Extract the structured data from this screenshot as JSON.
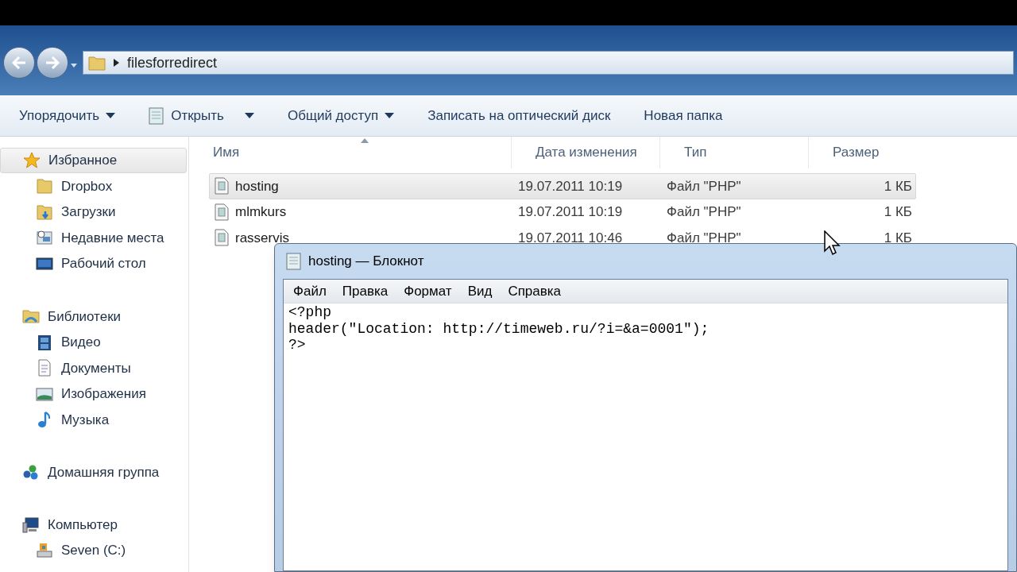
{
  "explorer": {
    "address": {
      "path": "filesforredirect"
    },
    "toolbar": [
      {
        "label": "Упорядочить",
        "kind": "dropdown"
      },
      {
        "label": "Открыть",
        "kind": "open"
      },
      {
        "label": "Общий доступ",
        "kind": "dropdown"
      },
      {
        "label": "Записать на оптический диск",
        "kind": "plain"
      },
      {
        "label": "Новая папка",
        "kind": "plain"
      }
    ],
    "sidebar": [
      {
        "label": "Избранное",
        "selected": true,
        "children": [
          {
            "label": "Dropbox"
          },
          {
            "label": "Загрузки"
          },
          {
            "label": "Недавние места"
          },
          {
            "label": "Рабочий стол"
          }
        ]
      },
      {
        "label": "Библиотеки",
        "selected": false,
        "children": [
          {
            "label": "Видео"
          },
          {
            "label": "Документы"
          },
          {
            "label": "Изображения"
          },
          {
            "label": "Музыка"
          }
        ]
      },
      {
        "label": "Домашняя группа",
        "selected": false
      },
      {
        "label": "Компьютер",
        "selected": false,
        "children": [
          {
            "label": "Seven (C:)"
          }
        ]
      }
    ],
    "table": {
      "columns": [
        "Имя",
        "Дата изменения",
        "Тип",
        "Размер"
      ],
      "rows": [
        {
          "name": "hosting",
          "date": "19.07.2011 10:19",
          "type": "Файл \"PHP\"",
          "size": "1 КБ",
          "selected": true
        },
        {
          "name": "mlmkurs",
          "date": "19.07.2011 10:19",
          "type": "Файл \"PHP\"",
          "size": "1 КБ",
          "selected": false
        },
        {
          "name": "rasservis",
          "date": "19.07.2011 10:46",
          "type": "Файл \"PHP\"",
          "size": "1 КБ",
          "selected": false
        }
      ]
    }
  },
  "notepad": {
    "title": "hosting — Блокнот",
    "menu": [
      "Файл",
      "Правка",
      "Формат",
      "Вид",
      "Справка"
    ],
    "lines": [
      "<?php",
      "header(\"Location: http://timeweb.ru/?i=&a=0001\");",
      "?>"
    ]
  }
}
